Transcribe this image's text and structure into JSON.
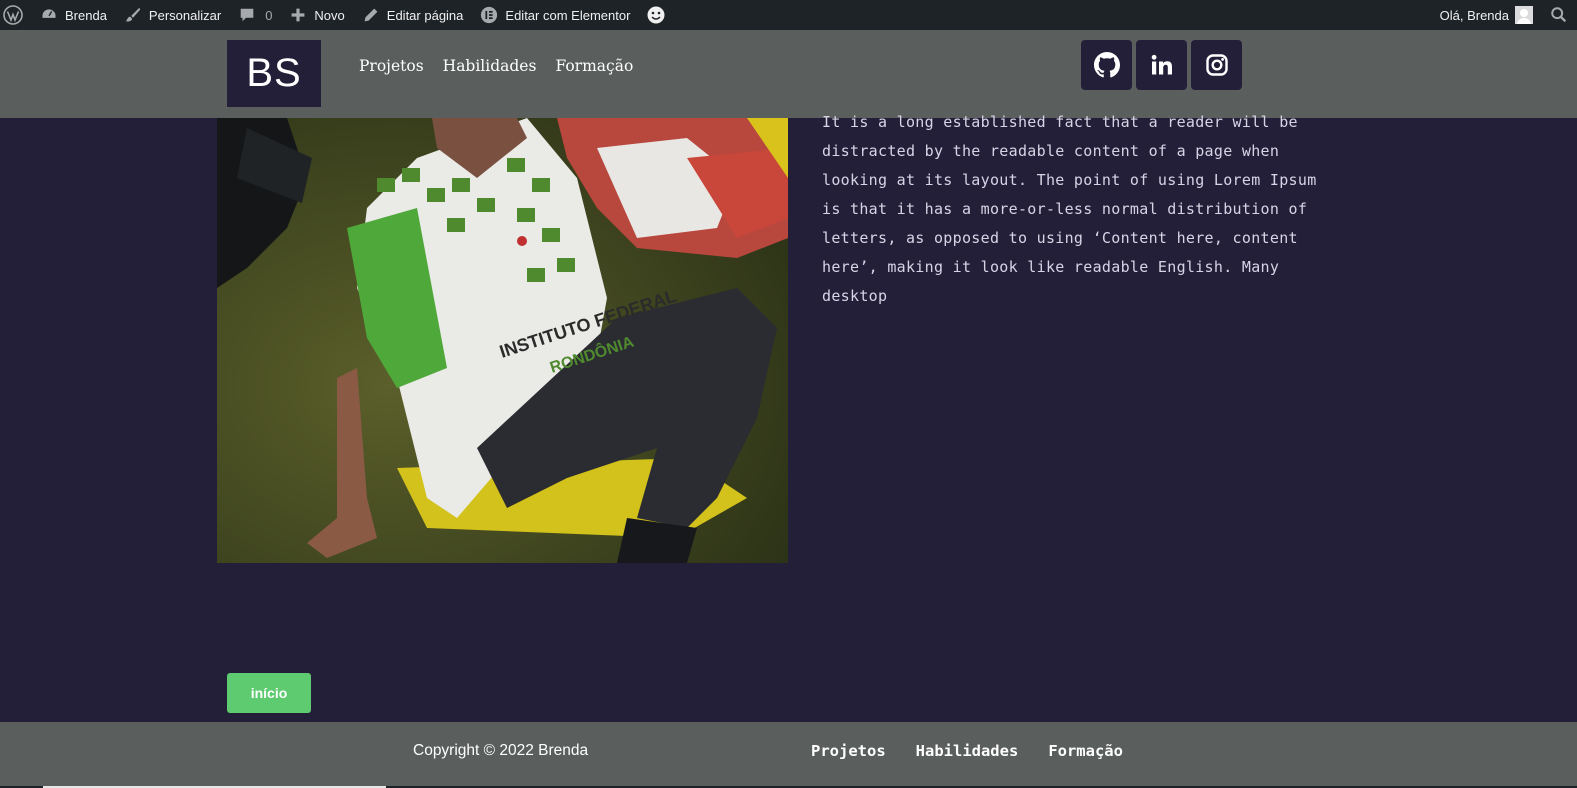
{
  "admin_bar": {
    "site_name": "Brenda",
    "customize": "Personalizar",
    "comments_count": "0",
    "new": "Novo",
    "edit_page": "Editar página",
    "edit_elementor": "Editar com Elementor",
    "greeting": "Olá, Brenda"
  },
  "header": {
    "logo_text": "BS",
    "nav": [
      "Projetos",
      "Habilidades",
      "Formação"
    ],
    "social": [
      "github-icon",
      "linkedin-icon",
      "instagram-icon"
    ]
  },
  "main": {
    "photo_print": "INSTITUTO FEDERAL RONDÔNIA",
    "body_text": "It is a long established fact that a reader will be distracted by the readable content of a page when looking at its layout. The point of using Lorem Ipsum is that it has a more-or-less normal distribution of letters, as opposed to using ‘Content here, content here’, making it look like readable English. Many desktop",
    "button_label": "início"
  },
  "footer": {
    "copyright": "Copyright © 2022 Brenda",
    "nav": [
      "Projetos",
      "Habilidades",
      "Formação"
    ]
  },
  "colors": {
    "page_bg": "#231f39",
    "header_bg": "#5a5f5d",
    "admin_bar_bg": "#1d2327",
    "button_bg": "#5fcb71"
  }
}
